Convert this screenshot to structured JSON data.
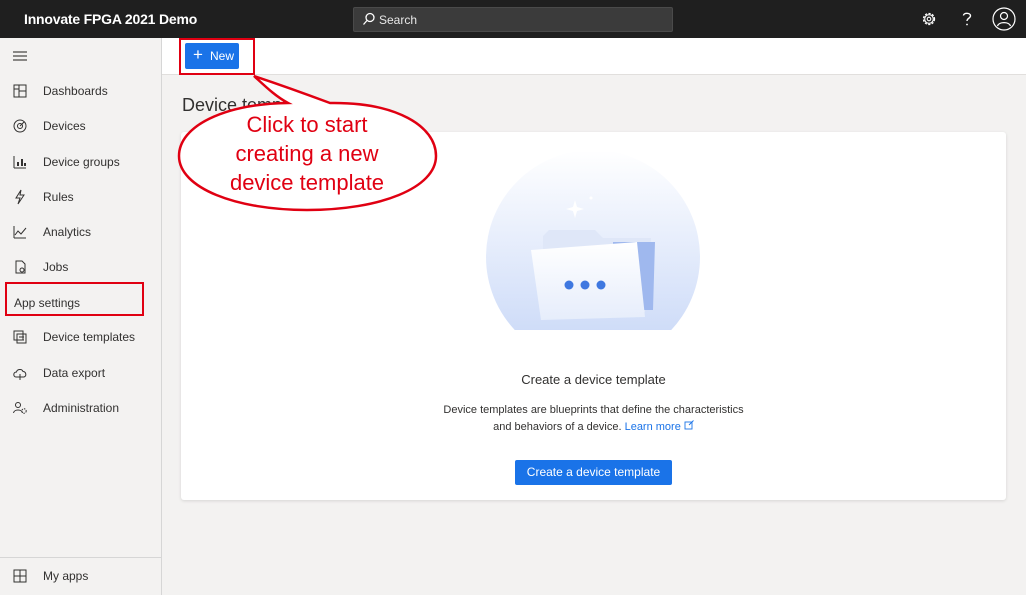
{
  "app": {
    "title": "Innovate FPGA 2021 Demo"
  },
  "search": {
    "placeholder": "Search"
  },
  "header_icons": [
    "settings-icon",
    "help-icon",
    "user-icon"
  ],
  "sidebar": {
    "items": [
      {
        "label": "Dashboards",
        "icon": "dashboard-icon"
      },
      {
        "label": "Devices",
        "icon": "devices-icon"
      },
      {
        "label": "Device groups",
        "icon": "device-groups-icon"
      },
      {
        "label": "Rules",
        "icon": "rules-icon"
      },
      {
        "label": "Analytics",
        "icon": "analytics-icon"
      },
      {
        "label": "Jobs",
        "icon": "jobs-icon"
      }
    ],
    "section_label": "App settings",
    "settings_items": [
      {
        "label": "Device templates",
        "icon": "device-templates-icon",
        "selected": true
      },
      {
        "label": "Data export",
        "icon": "data-export-icon"
      },
      {
        "label": "Administration",
        "icon": "administration-icon"
      }
    ],
    "footer_item": {
      "label": "My apps",
      "icon": "my-apps-icon"
    }
  },
  "commandbar": {
    "new_label": "New"
  },
  "page": {
    "title": "Device templates"
  },
  "empty_state": {
    "title": "Create a device template",
    "description_line1": "Device templates are blueprints that define the characteristics",
    "description_line2": "and behaviors of a device.",
    "learn_more": "Learn more",
    "button_label": "Create a device template"
  },
  "callout": {
    "line1": "Click to start",
    "line2": "creating a new",
    "line3": "device template"
  },
  "colors": {
    "accent": "#1a73e8",
    "annotation": "#e00012",
    "topbar": "#1f1f1f"
  }
}
